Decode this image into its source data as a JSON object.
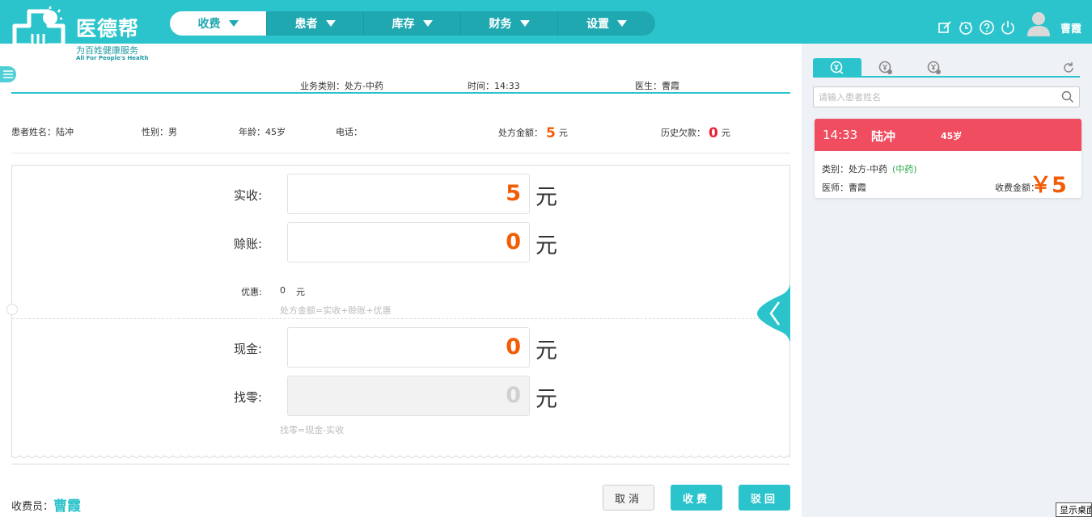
{
  "app": {
    "name": "医德帮",
    "slogan": "为百姓健康服务",
    "slogan_en": "All For People's Health",
    "accent_color": "#2cc4cc"
  },
  "nav": {
    "items": [
      {
        "label": "收费",
        "active": true
      },
      {
        "label": "患者"
      },
      {
        "label": "库存"
      },
      {
        "label": "财务"
      },
      {
        "label": "设置"
      }
    ]
  },
  "header": {
    "icons": [
      "edit-icon",
      "timer-icon",
      "help-icon",
      "power-icon"
    ],
    "username": "曹霞"
  },
  "order": {
    "business_type": "业务类别：处方-中药",
    "time": "时间：14:33",
    "doctor": "医生：曹霞"
  },
  "patient": {
    "name_label": "患者姓名：",
    "name": "陆冲",
    "gender_label": "性别：",
    "gender": "男",
    "age_label": "年龄：",
    "age": "45岁",
    "phone_label": "电话：",
    "phone": "",
    "rx_amount_label": "处方金额：",
    "rx_amount": "5",
    "rx_amount_unit": "元",
    "debt_label": "历史欠款：",
    "debt": "0",
    "debt_unit": "元"
  },
  "payment": {
    "received_label": "实收:",
    "received": "5",
    "credit_label": "赊账:",
    "credit": "0",
    "discount_label": "优惠:",
    "discount": "0",
    "discount_unit": "元",
    "formula1": "处方金额=实收+赊账+优惠",
    "cash_label": "现金:",
    "cash": "0",
    "change_label": "找零:",
    "change": "0",
    "formula2": "找零=现金-实收",
    "unit": "元"
  },
  "footer": {
    "collector_label": "收费员：",
    "collector": "曹霞",
    "cancel": "取消",
    "charge": "收费",
    "reject": "驳回"
  },
  "right": {
    "search_placeholder": "请输入患者姓名",
    "card": {
      "time": "14:33",
      "name": "陆冲",
      "age": "45岁",
      "category_label": "类别：",
      "category": "处方-中药",
      "category_tag": "(中药)",
      "doctor_label": "医师：",
      "doctor": "曹霞",
      "fee_label": "收费金额：",
      "fee": "￥5",
      "header_color": "#f04d60"
    }
  },
  "taskbar_tip": "显示桌面"
}
